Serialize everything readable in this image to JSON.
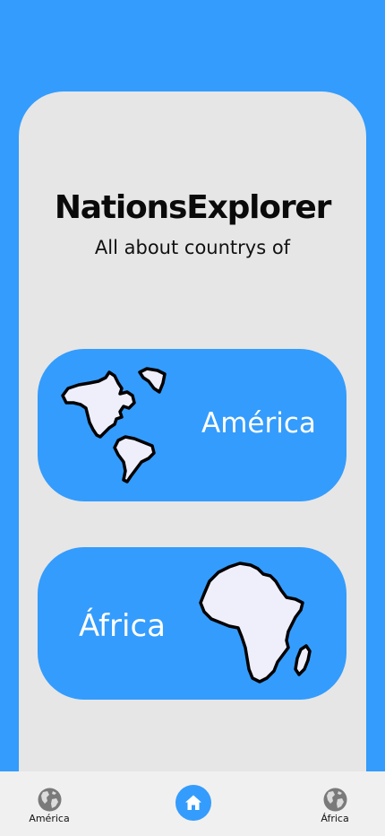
{
  "app": {
    "title": "NationsExplorer",
    "subtitle": "All about countrys of"
  },
  "regions": [
    {
      "label": "América",
      "icon": "americas-map-icon"
    },
    {
      "label": "África",
      "icon": "africa-map-icon"
    }
  ],
  "bottom_nav": {
    "left": {
      "label": "América",
      "icon": "globe-icon"
    },
    "center": {
      "icon": "home-icon"
    },
    "right": {
      "label": "África",
      "icon": "globe-icon"
    }
  },
  "colors": {
    "primary": "#349cfc",
    "card_background": "#e6e6e6",
    "nav_background": "#f0f0f0",
    "map_fill": "#efeefb",
    "text_dark": "#0a0a0a",
    "text_light": "#ffffff"
  }
}
